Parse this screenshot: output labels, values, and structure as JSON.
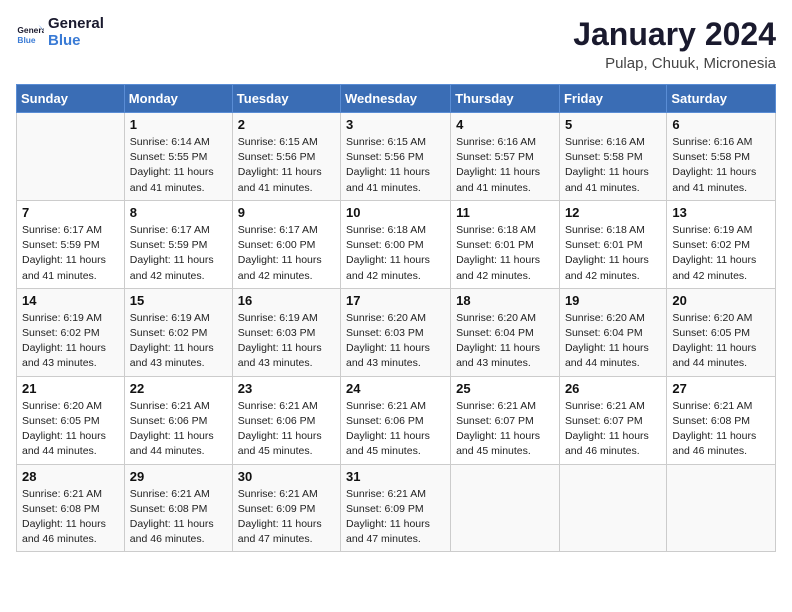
{
  "logo": {
    "line1": "General",
    "line2": "Blue"
  },
  "title": "January 2024",
  "subtitle": "Pulap, Chuuk, Micronesia",
  "days_of_week": [
    "Sunday",
    "Monday",
    "Tuesday",
    "Wednesday",
    "Thursday",
    "Friday",
    "Saturday"
  ],
  "weeks": [
    [
      {
        "num": "",
        "sunrise": "",
        "sunset": "",
        "daylight": ""
      },
      {
        "num": "1",
        "sunrise": "Sunrise: 6:14 AM",
        "sunset": "Sunset: 5:55 PM",
        "daylight": "Daylight: 11 hours and 41 minutes."
      },
      {
        "num": "2",
        "sunrise": "Sunrise: 6:15 AM",
        "sunset": "Sunset: 5:56 PM",
        "daylight": "Daylight: 11 hours and 41 minutes."
      },
      {
        "num": "3",
        "sunrise": "Sunrise: 6:15 AM",
        "sunset": "Sunset: 5:56 PM",
        "daylight": "Daylight: 11 hours and 41 minutes."
      },
      {
        "num": "4",
        "sunrise": "Sunrise: 6:16 AM",
        "sunset": "Sunset: 5:57 PM",
        "daylight": "Daylight: 11 hours and 41 minutes."
      },
      {
        "num": "5",
        "sunrise": "Sunrise: 6:16 AM",
        "sunset": "Sunset: 5:58 PM",
        "daylight": "Daylight: 11 hours and 41 minutes."
      },
      {
        "num": "6",
        "sunrise": "Sunrise: 6:16 AM",
        "sunset": "Sunset: 5:58 PM",
        "daylight": "Daylight: 11 hours and 41 minutes."
      }
    ],
    [
      {
        "num": "7",
        "sunrise": "Sunrise: 6:17 AM",
        "sunset": "Sunset: 5:59 PM",
        "daylight": "Daylight: 11 hours and 41 minutes."
      },
      {
        "num": "8",
        "sunrise": "Sunrise: 6:17 AM",
        "sunset": "Sunset: 5:59 PM",
        "daylight": "Daylight: 11 hours and 42 minutes."
      },
      {
        "num": "9",
        "sunrise": "Sunrise: 6:17 AM",
        "sunset": "Sunset: 6:00 PM",
        "daylight": "Daylight: 11 hours and 42 minutes."
      },
      {
        "num": "10",
        "sunrise": "Sunrise: 6:18 AM",
        "sunset": "Sunset: 6:00 PM",
        "daylight": "Daylight: 11 hours and 42 minutes."
      },
      {
        "num": "11",
        "sunrise": "Sunrise: 6:18 AM",
        "sunset": "Sunset: 6:01 PM",
        "daylight": "Daylight: 11 hours and 42 minutes."
      },
      {
        "num": "12",
        "sunrise": "Sunrise: 6:18 AM",
        "sunset": "Sunset: 6:01 PM",
        "daylight": "Daylight: 11 hours and 42 minutes."
      },
      {
        "num": "13",
        "sunrise": "Sunrise: 6:19 AM",
        "sunset": "Sunset: 6:02 PM",
        "daylight": "Daylight: 11 hours and 42 minutes."
      }
    ],
    [
      {
        "num": "14",
        "sunrise": "Sunrise: 6:19 AM",
        "sunset": "Sunset: 6:02 PM",
        "daylight": "Daylight: 11 hours and 43 minutes."
      },
      {
        "num": "15",
        "sunrise": "Sunrise: 6:19 AM",
        "sunset": "Sunset: 6:02 PM",
        "daylight": "Daylight: 11 hours and 43 minutes."
      },
      {
        "num": "16",
        "sunrise": "Sunrise: 6:19 AM",
        "sunset": "Sunset: 6:03 PM",
        "daylight": "Daylight: 11 hours and 43 minutes."
      },
      {
        "num": "17",
        "sunrise": "Sunrise: 6:20 AM",
        "sunset": "Sunset: 6:03 PM",
        "daylight": "Daylight: 11 hours and 43 minutes."
      },
      {
        "num": "18",
        "sunrise": "Sunrise: 6:20 AM",
        "sunset": "Sunset: 6:04 PM",
        "daylight": "Daylight: 11 hours and 43 minutes."
      },
      {
        "num": "19",
        "sunrise": "Sunrise: 6:20 AM",
        "sunset": "Sunset: 6:04 PM",
        "daylight": "Daylight: 11 hours and 44 minutes."
      },
      {
        "num": "20",
        "sunrise": "Sunrise: 6:20 AM",
        "sunset": "Sunset: 6:05 PM",
        "daylight": "Daylight: 11 hours and 44 minutes."
      }
    ],
    [
      {
        "num": "21",
        "sunrise": "Sunrise: 6:20 AM",
        "sunset": "Sunset: 6:05 PM",
        "daylight": "Daylight: 11 hours and 44 minutes."
      },
      {
        "num": "22",
        "sunrise": "Sunrise: 6:21 AM",
        "sunset": "Sunset: 6:06 PM",
        "daylight": "Daylight: 11 hours and 44 minutes."
      },
      {
        "num": "23",
        "sunrise": "Sunrise: 6:21 AM",
        "sunset": "Sunset: 6:06 PM",
        "daylight": "Daylight: 11 hours and 45 minutes."
      },
      {
        "num": "24",
        "sunrise": "Sunrise: 6:21 AM",
        "sunset": "Sunset: 6:06 PM",
        "daylight": "Daylight: 11 hours and 45 minutes."
      },
      {
        "num": "25",
        "sunrise": "Sunrise: 6:21 AM",
        "sunset": "Sunset: 6:07 PM",
        "daylight": "Daylight: 11 hours and 45 minutes."
      },
      {
        "num": "26",
        "sunrise": "Sunrise: 6:21 AM",
        "sunset": "Sunset: 6:07 PM",
        "daylight": "Daylight: 11 hours and 46 minutes."
      },
      {
        "num": "27",
        "sunrise": "Sunrise: 6:21 AM",
        "sunset": "Sunset: 6:08 PM",
        "daylight": "Daylight: 11 hours and 46 minutes."
      }
    ],
    [
      {
        "num": "28",
        "sunrise": "Sunrise: 6:21 AM",
        "sunset": "Sunset: 6:08 PM",
        "daylight": "Daylight: 11 hours and 46 minutes."
      },
      {
        "num": "29",
        "sunrise": "Sunrise: 6:21 AM",
        "sunset": "Sunset: 6:08 PM",
        "daylight": "Daylight: 11 hours and 46 minutes."
      },
      {
        "num": "30",
        "sunrise": "Sunrise: 6:21 AM",
        "sunset": "Sunset: 6:09 PM",
        "daylight": "Daylight: 11 hours and 47 minutes."
      },
      {
        "num": "31",
        "sunrise": "Sunrise: 6:21 AM",
        "sunset": "Sunset: 6:09 PM",
        "daylight": "Daylight: 11 hours and 47 minutes."
      },
      {
        "num": "",
        "sunrise": "",
        "sunset": "",
        "daylight": ""
      },
      {
        "num": "",
        "sunrise": "",
        "sunset": "",
        "daylight": ""
      },
      {
        "num": "",
        "sunrise": "",
        "sunset": "",
        "daylight": ""
      }
    ]
  ]
}
